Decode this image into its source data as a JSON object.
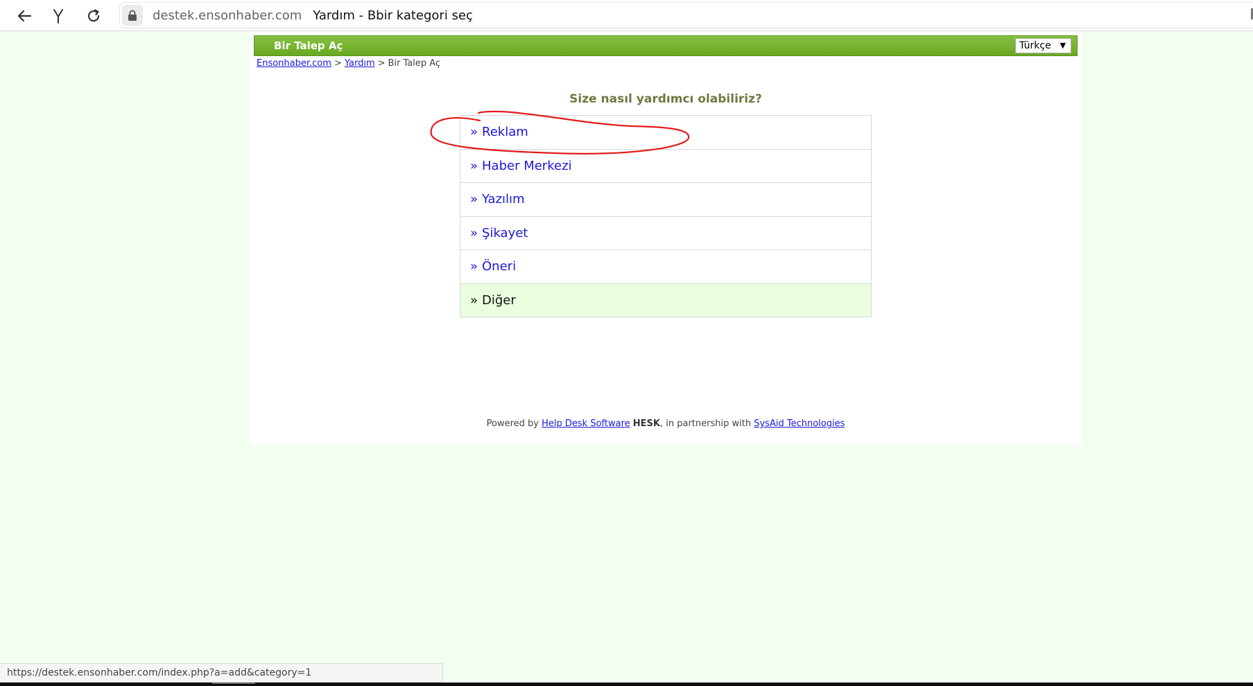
{
  "browser": {
    "url_domain": "destek.ensonhaber.com",
    "page_title": "Yardım - Bbir kategori seç",
    "status_url": "https://destek.ensonhaber.com/index.php?a=add&category=1"
  },
  "header": {
    "title": "Bir Talep Aç",
    "language": "Türkçe"
  },
  "breadcrumb": {
    "items": [
      "Ensonhaber.com",
      "Yardım",
      "Bir Talep Aç"
    ],
    "separator": ">"
  },
  "question": "Size nasıl yardımcı olabiliriz?",
  "categories": {
    "prefix": "»",
    "items": [
      {
        "label": "Reklam"
      },
      {
        "label": "Haber Merkezi"
      },
      {
        "label": "Yazılım"
      },
      {
        "label": "Şikayet"
      },
      {
        "label": "Öneri"
      },
      {
        "label": "Diğer"
      }
    ]
  },
  "footer": {
    "powered_by": "Powered by",
    "link1": "Help Desk Software",
    "brand": "HESK",
    "partnership": ", in partnership with",
    "link2": "SysAid Technologies"
  },
  "colors": {
    "header_green": "#72b02b",
    "link_blue": "#1a17d8",
    "page_bg": "#f2fef0",
    "hover_bg": "#eaffde",
    "annotation_red": "#e31b1b"
  },
  "icons": {
    "back": "arrow-left-icon",
    "yandex": "yandex-y-icon",
    "reload": "reload-icon",
    "lock": "lock-icon"
  }
}
